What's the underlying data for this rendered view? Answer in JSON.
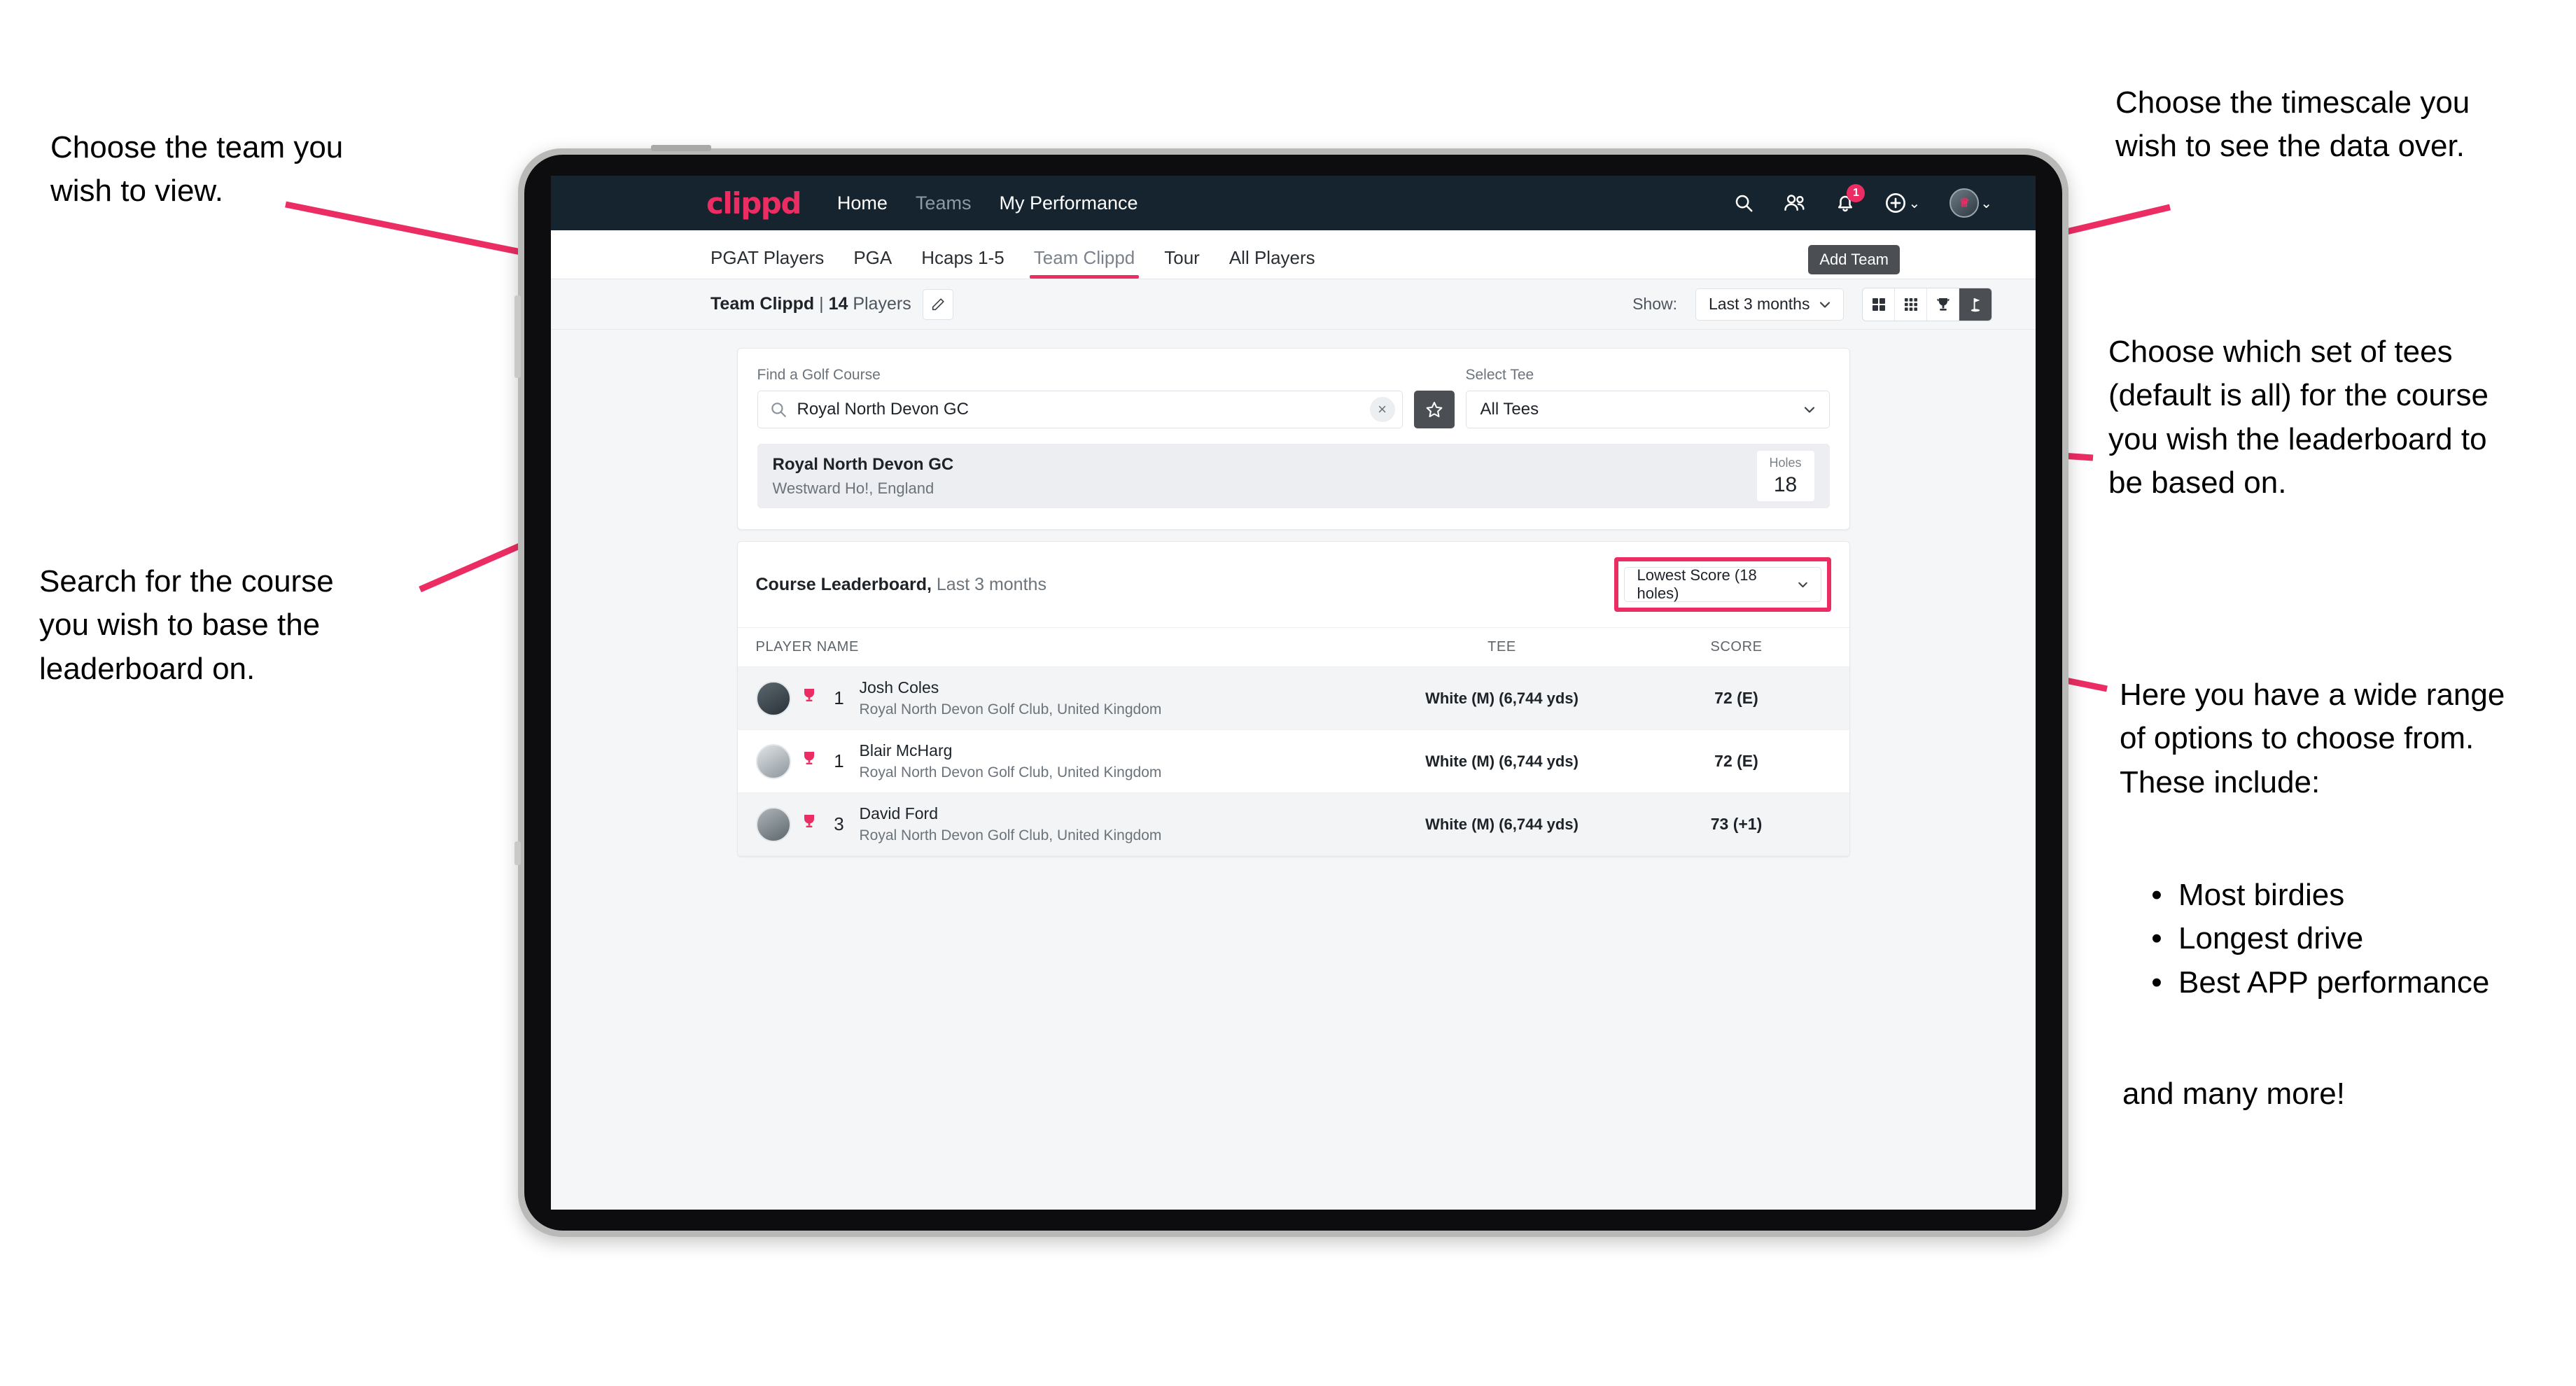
{
  "app": {
    "logo": "clippd",
    "nav": [
      {
        "label": "Home",
        "dim": false
      },
      {
        "label": "Teams",
        "dim": true
      },
      {
        "label": "My Performance",
        "dim": false
      }
    ],
    "header_icons": [
      {
        "name": "search-icon"
      },
      {
        "name": "people-icon"
      },
      {
        "name": "bell-icon",
        "badge": "1"
      },
      {
        "name": "plus-circle-icon"
      },
      {
        "name": "avatar-icon"
      }
    ],
    "notification_count": "1"
  },
  "tabs": [
    {
      "label": "PGAT Players",
      "active": false
    },
    {
      "label": "PGA",
      "active": false
    },
    {
      "label": "Hcaps 1-5",
      "active": false
    },
    {
      "label": "Team Clippd",
      "active": true
    },
    {
      "label": "Tour",
      "active": false
    },
    {
      "label": "All Players",
      "active": false
    }
  ],
  "tooltip": {
    "add_team": "Add Team"
  },
  "toolbar": {
    "team_name": "Team Clippd",
    "separator": "|",
    "player_count": "14",
    "players_word": "Players",
    "edit_icon": "pencil-icon",
    "show_label": "Show:",
    "timescale_value": "Last 3 months",
    "view_modes": [
      {
        "name": "grid-2x2-icon",
        "active": false
      },
      {
        "name": "grid-3x3-icon",
        "active": false
      },
      {
        "name": "trophy-icon",
        "active": false
      },
      {
        "name": "golf-flag-icon",
        "active": true
      }
    ]
  },
  "search_card": {
    "course_label": "Find a Golf Course",
    "course_value": "Royal North Devon GC",
    "course_placeholder": "Find a Golf Course",
    "clear_label": "×",
    "star_icon": "star-icon",
    "tee_label": "Select Tee",
    "tee_value": "All Tees"
  },
  "course_result": {
    "name": "Royal North Devon GC",
    "location": "Westward Ho!, England",
    "holes_label": "Holes",
    "holes_value": "18"
  },
  "leaderboard": {
    "title": "Course Leaderboard,",
    "subtitle": "Last 3 months",
    "sort_value": "Lowest Score (18 holes)",
    "columns": [
      "PLAYER NAME",
      "TEE",
      "SCORE"
    ],
    "rows": [
      {
        "rank": "1",
        "name": "Josh Coles",
        "club": "Royal North Devon Golf Club, United Kingdom",
        "tee": "White (M) (6,744 yds)",
        "score": "72 (E)"
      },
      {
        "rank": "1",
        "name": "Blair McHarg",
        "club": "Royal North Devon Golf Club, United Kingdom",
        "tee": "White (M) (6,744 yds)",
        "score": "72 (E)"
      },
      {
        "rank": "3",
        "name": "David Ford",
        "club": "Royal North Devon Golf Club, United Kingdom",
        "tee": "White (M) (6,744 yds)",
        "score": "73 (+1)"
      }
    ]
  },
  "annotations": {
    "top_left": "Choose the team you\nwish to view.",
    "bottom_left": "Search for the course\nyou wish to base the\nleaderboard on.",
    "top_right": "Choose the timescale you\nwish to see the data over.",
    "mid_right": "Choose which set of tees\n(default is all) for the course\nyou wish the leaderboard to\nbe based on.",
    "bottom_right_intro": "Here you have a wide range\nof options to choose from.\nThese include:",
    "bullets": [
      "Most birdies",
      "Longest drive",
      "Best APP performance"
    ],
    "bottom_right_outro": "and many more!"
  },
  "colors": {
    "accent": "#ec2d63",
    "header_bg": "#15242e",
    "dark_chip": "#4b4f54"
  }
}
